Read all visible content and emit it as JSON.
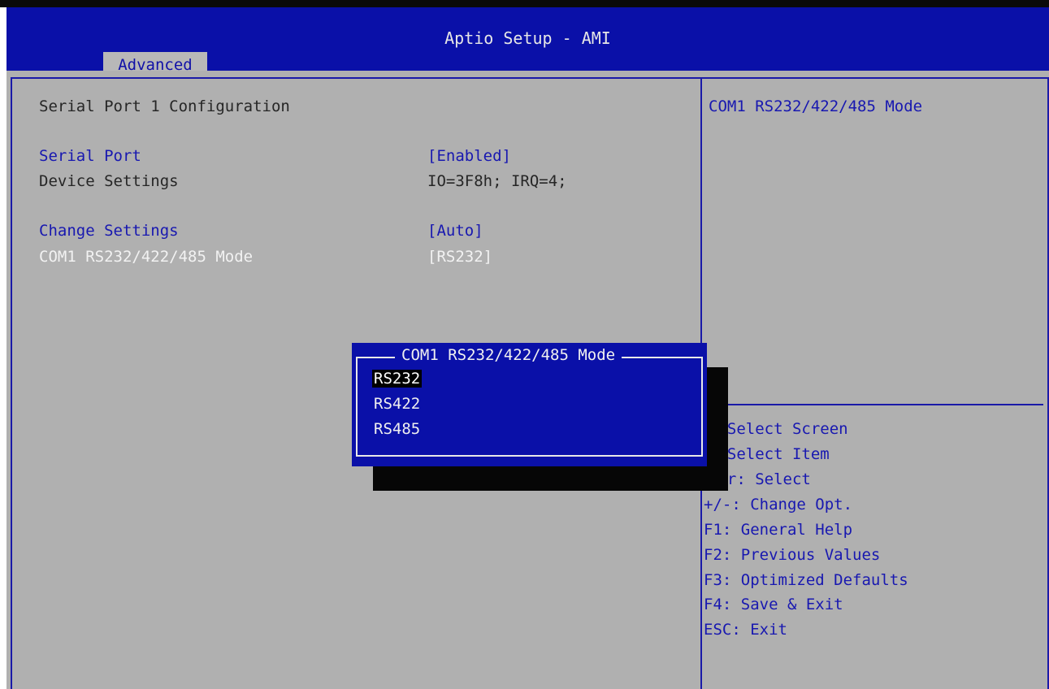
{
  "window": {
    "title": "Aptio Setup - AMI"
  },
  "tabs": [
    {
      "label": "Advanced",
      "active": true
    }
  ],
  "main": {
    "section_title": "Serial Port 1 Configuration",
    "items": [
      {
        "label": "Serial Port",
        "value": "[Enabled]"
      },
      {
        "label": "Device Settings",
        "value": "IO=3F8h; IRQ=4;"
      },
      {
        "label": "Change Settings",
        "value": "[Auto]"
      },
      {
        "label": "COM1 RS232/422/485 Mode",
        "value": "[RS232]"
      }
    ]
  },
  "help": {
    "description": "COM1 RS232/422/485 Mode",
    "keys": [
      ": Select Screen",
      ": Select Item",
      "ter: Select",
      "+/-: Change Opt.",
      "F1: General Help",
      "F2: Previous Values",
      "F3: Optimized Defaults",
      "F4: Save & Exit",
      "ESC: Exit"
    ]
  },
  "popup": {
    "title": "COM1 RS232/422/485 Mode",
    "options": [
      "RS232",
      "RS422",
      "RS485"
    ],
    "selected": "RS232"
  },
  "colors": {
    "header_bg": "#0a10a8",
    "body_bg": "#b0b0b0",
    "accent_text": "#1818b0",
    "selected_bg": "#000000"
  }
}
